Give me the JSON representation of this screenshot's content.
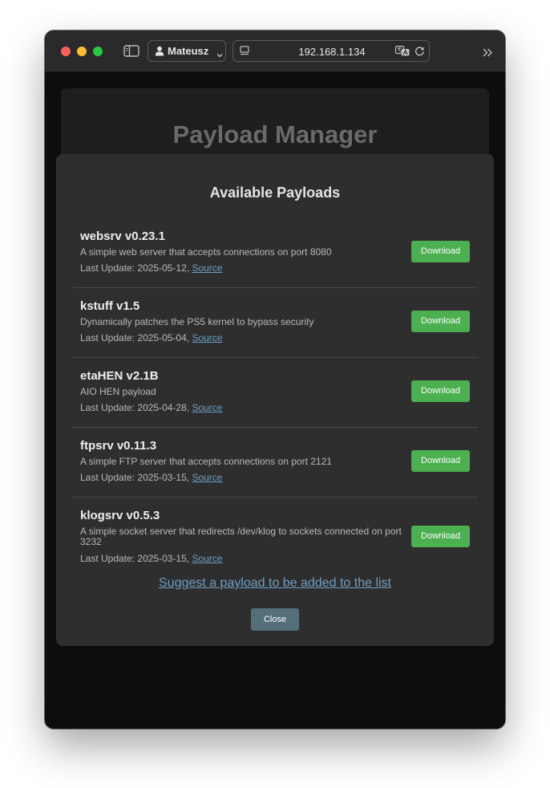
{
  "browser": {
    "profile_name": "Mateusz",
    "url": "192.168.1.134"
  },
  "page": {
    "title": "Payload Manager"
  },
  "modal": {
    "title": "Available Payloads",
    "last_update_label": "Last Update: ",
    "source_label": "Source",
    "download_label": "Download",
    "payloads": [
      {
        "name": "websrv v0.23.1",
        "description": "A simple web server that accepts connections on port 8080",
        "date": "2025-05-12,"
      },
      {
        "name": "kstuff v1.5",
        "description": "Dynamically patches the PS5 kernel to bypass security",
        "date": "2025-05-04,"
      },
      {
        "name": "etaHEN v2.1B",
        "description": "AIO HEN payload",
        "date": "2025-04-28,"
      },
      {
        "name": "ftpsrv v0.11.3",
        "description": "A simple FTP server that accepts connections on port 2121",
        "date": "2025-03-15,"
      },
      {
        "name": "klogsrv v0.5.3",
        "description": "A simple socket server that redirects /dev/klog to sockets connected on port 3232",
        "date": "2025-03-15,"
      }
    ],
    "suggest_link": "Suggest a payload to be added to the list",
    "close_label": "Close"
  },
  "colors": {
    "accent_green": "#4caf50",
    "link_blue": "#6f9fc4",
    "close_button": "#546e7a"
  },
  "icons": [
    "sidebar-icon",
    "person-icon",
    "chevron-down-icon",
    "page-icon",
    "translate-icon",
    "reload-icon",
    "double-chevron-right-icon"
  ]
}
